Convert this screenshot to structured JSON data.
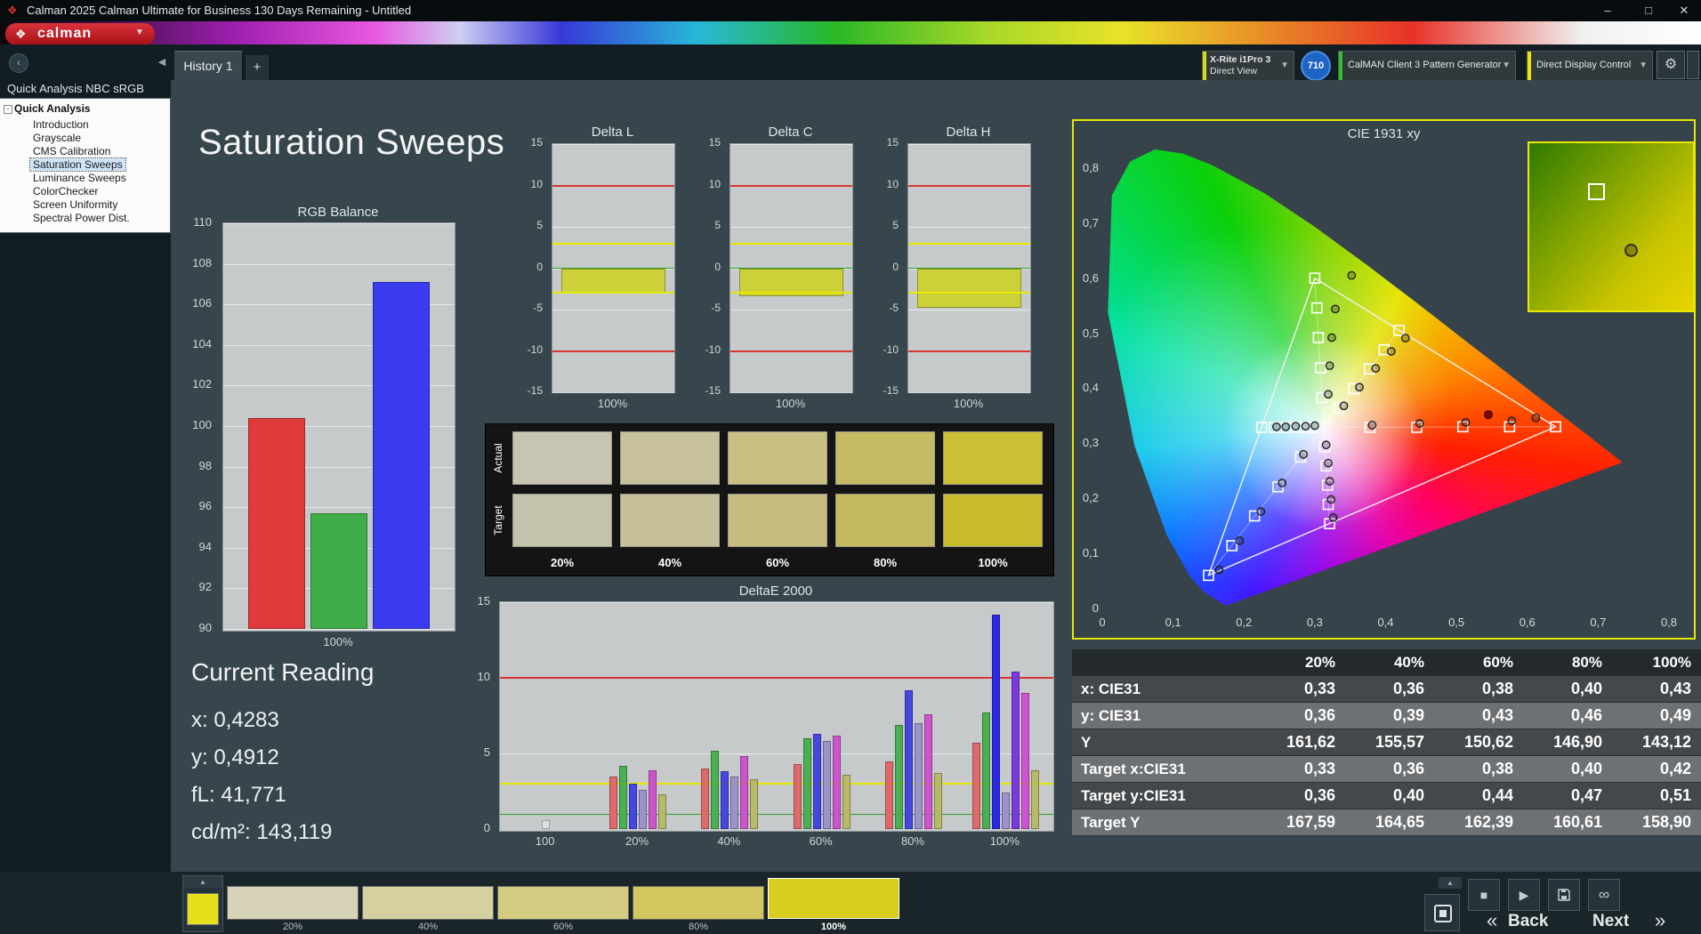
{
  "window": {
    "title": "Calman 2025 Calman Ultimate for Business 130 Days Remaining - Untitled",
    "minimize": "–",
    "maximize": "□",
    "close": "✕"
  },
  "logo": {
    "text": "calman"
  },
  "tabs": {
    "active": "History 1",
    "add_label": "+"
  },
  "devices": {
    "meter_line1": "X-Rite i1Pro 3",
    "meter_line2": "Direct View",
    "badge": "710",
    "pattern": "CalMAN Client 3 Pattern Generator",
    "display": "Direct Display Control"
  },
  "sidebar": {
    "workflow_title": "Quick Analysis NBC sRGB",
    "root": "Quick Analysis",
    "items": [
      "Introduction",
      "Grayscale",
      "CMS Calibration",
      "Saturation Sweeps",
      "Luminance Sweeps",
      "ColorChecker",
      "Screen Uniformity",
      "Spectral Power Dist."
    ],
    "selected": "Saturation Sweeps"
  },
  "page": {
    "title": "Saturation Sweeps"
  },
  "current_reading": {
    "title": "Current Reading",
    "x": "x: 0,4283",
    "y": "y: 0,4912",
    "fl": "fL: 41,771",
    "cd": "cd/m²: 143,119"
  },
  "rgb_chart": {
    "type": "bar",
    "title": "RGB Balance",
    "xlabel": "100%",
    "ymin": 90,
    "ymax": 110,
    "yticks": [
      110,
      108,
      106,
      104,
      102,
      100,
      98,
      96,
      94,
      92,
      90
    ],
    "bars": [
      {
        "name": "red",
        "color": "#e03a3a",
        "value": 100.4
      },
      {
        "name": "green",
        "color": "#3fae4a",
        "value": 95.7
      },
      {
        "name": "blue",
        "color": "#3a3aee",
        "value": 107.1
      }
    ]
  },
  "delta_charts": {
    "type": "bar",
    "ymin": -15,
    "ymax": 15,
    "yticks": [
      15,
      10,
      5,
      0,
      -5,
      -10,
      -15
    ],
    "xlabel": "100%",
    "bar_color": "#ccd13a",
    "limit_lines": [
      {
        "v": 10,
        "color": "#d83434",
        "w": 2
      },
      {
        "v": -10,
        "color": "#d83434",
        "w": 2
      },
      {
        "v": 3,
        "color": "#e8e800",
        "w": 2
      },
      {
        "v": -3,
        "color": "#e8e800",
        "w": 2
      },
      {
        "v": 0,
        "color": "#2aa02a",
        "w": 1
      }
    ],
    "charts": [
      {
        "title": "Delta L",
        "value": -3.0
      },
      {
        "title": "Delta C",
        "value": -3.4
      },
      {
        "title": "Delta H",
        "value": -4.8
      }
    ]
  },
  "swatch_table": {
    "row_labels": [
      "Actual",
      "Target"
    ],
    "col_labels": [
      "20%",
      "40%",
      "60%",
      "80%",
      "100%"
    ],
    "actual": [
      "#c7c4b1",
      "#c8c29c",
      "#c8bf83",
      "#c6ba62",
      "#cbbf33"
    ],
    "target": [
      "#c4c1ad",
      "#c6c098",
      "#c7bd80",
      "#c5b95f",
      "#c9bc2c"
    ]
  },
  "deltae_chart": {
    "type": "bar",
    "title": "DeltaE 2000",
    "ymin": 0,
    "ymax": 15,
    "yticks": [
      0,
      5,
      10,
      15
    ],
    "limit_lines": [
      {
        "v": 10,
        "color": "#d83434",
        "w": 2
      },
      {
        "v": 3,
        "color": "#e8e800",
        "w": 2
      },
      {
        "v": 1,
        "color": "#2aa02a",
        "w": 1
      }
    ],
    "groups": [
      {
        "label": "100",
        "bars": [
          {
            "c": "#e0e0e0",
            "v": 0.6
          }
        ]
      },
      {
        "label": "20%",
        "bars": [
          {
            "c": "#e06a6a",
            "v": 3.5
          },
          {
            "c": "#4ab051",
            "v": 4.2
          },
          {
            "c": "#4646e0",
            "v": 3.0
          },
          {
            "c": "#9b93c9",
            "v": 2.6
          },
          {
            "c": "#cc55cc",
            "v": 3.9
          },
          {
            "c": "#b9b96a",
            "v": 2.3
          }
        ]
      },
      {
        "label": "40%",
        "bars": [
          {
            "c": "#e06a6a",
            "v": 4.0
          },
          {
            "c": "#4ab051",
            "v": 5.2
          },
          {
            "c": "#4646e0",
            "v": 3.8
          },
          {
            "c": "#9b93c9",
            "v": 3.5
          },
          {
            "c": "#cc55cc",
            "v": 4.8
          },
          {
            "c": "#b9b96a",
            "v": 3.3
          }
        ]
      },
      {
        "label": "60%",
        "bars": [
          {
            "c": "#e06a6a",
            "v": 4.3
          },
          {
            "c": "#4ab051",
            "v": 6.0
          },
          {
            "c": "#4646e0",
            "v": 6.3
          },
          {
            "c": "#9b93c9",
            "v": 5.8
          },
          {
            "c": "#cc55cc",
            "v": 6.2
          },
          {
            "c": "#b9b96a",
            "v": 3.6
          }
        ]
      },
      {
        "label": "80%",
        "bars": [
          {
            "c": "#e06a6a",
            "v": 4.5
          },
          {
            "c": "#4ab051",
            "v": 6.9
          },
          {
            "c": "#4646e0",
            "v": 9.2
          },
          {
            "c": "#9b93c9",
            "v": 7.0
          },
          {
            "c": "#cc55cc",
            "v": 7.6
          },
          {
            "c": "#b9b96a",
            "v": 3.7
          }
        ]
      },
      {
        "label": "100%",
        "bars": [
          {
            "c": "#e06a6a",
            "v": 5.7
          },
          {
            "c": "#4ab051",
            "v": 7.7
          },
          {
            "c": "#2a2ae8",
            "v": 14.2
          },
          {
            "c": "#9b93c9",
            "v": 2.4
          },
          {
            "c": "#7a3ae0",
            "v": 10.4
          },
          {
            "c": "#d054d0",
            "v": 9.0
          },
          {
            "c": "#b9b96a",
            "v": 3.9
          }
        ]
      }
    ]
  },
  "cie_chart": {
    "type": "scatter",
    "title": "CIE 1931 xy",
    "tick_labels": [
      "0",
      "0,1",
      "0,2",
      "0,3",
      "0,4",
      "0,5",
      "0,6",
      "0,7",
      "0,8"
    ],
    "xmax": 0.8,
    "ymax": 0.85,
    "triangle": [
      [
        0.64,
        0.33
      ],
      [
        0.3,
        0.6
      ],
      [
        0.15,
        0.06
      ]
    ],
    "white_point": [
      0.3127,
      0.329
    ],
    "sweep_ends": [
      [
        0.64,
        0.33
      ],
      [
        0.3,
        0.6
      ],
      [
        0.15,
        0.06
      ],
      [
        0.419,
        0.505
      ],
      [
        0.225,
        0.329
      ],
      [
        0.321,
        0.154
      ]
    ],
    "targets": [
      [
        0.378,
        0.329
      ],
      [
        0.444,
        0.329
      ],
      [
        0.509,
        0.33
      ],
      [
        0.575,
        0.33
      ],
      [
        0.64,
        0.33
      ],
      [
        0.31,
        0.383
      ],
      [
        0.308,
        0.437
      ],
      [
        0.305,
        0.492
      ],
      [
        0.303,
        0.546
      ],
      [
        0.3,
        0.6
      ],
      [
        0.28,
        0.275
      ],
      [
        0.248,
        0.221
      ],
      [
        0.215,
        0.168
      ],
      [
        0.183,
        0.114
      ],
      [
        0.15,
        0.06
      ],
      [
        0.334,
        0.364
      ],
      [
        0.355,
        0.399
      ],
      [
        0.377,
        0.435
      ],
      [
        0.398,
        0.47
      ],
      [
        0.419,
        0.505
      ],
      [
        0.295,
        0.329
      ],
      [
        0.278,
        0.329
      ],
      [
        0.26,
        0.329
      ],
      [
        0.243,
        0.329
      ],
      [
        0.225,
        0.329
      ],
      [
        0.314,
        0.294
      ],
      [
        0.316,
        0.259
      ],
      [
        0.318,
        0.224
      ],
      [
        0.319,
        0.189
      ],
      [
        0.321,
        0.154
      ]
    ],
    "measured": [
      [
        0.381,
        0.333
      ],
      [
        0.448,
        0.336
      ],
      [
        0.513,
        0.338
      ],
      [
        0.578,
        0.341
      ],
      [
        0.612,
        0.346
      ],
      [
        0.319,
        0.389
      ],
      [
        0.321,
        0.441
      ],
      [
        0.324,
        0.492
      ],
      [
        0.329,
        0.544
      ],
      [
        0.352,
        0.605
      ],
      [
        0.284,
        0.28
      ],
      [
        0.254,
        0.228
      ],
      [
        0.224,
        0.176
      ],
      [
        0.194,
        0.123
      ],
      [
        0.165,
        0.07
      ],
      [
        0.341,
        0.368
      ],
      [
        0.363,
        0.402
      ],
      [
        0.386,
        0.436
      ],
      [
        0.408,
        0.467
      ],
      [
        0.428,
        0.491
      ],
      [
        0.3,
        0.332
      ],
      [
        0.287,
        0.331
      ],
      [
        0.273,
        0.331
      ],
      [
        0.259,
        0.33
      ],
      [
        0.246,
        0.33
      ],
      [
        0.316,
        0.297
      ],
      [
        0.319,
        0.264
      ],
      [
        0.321,
        0.231
      ],
      [
        0.323,
        0.198
      ],
      [
        0.326,
        0.165
      ]
    ],
    "measured_filled": [
      [
        0.545,
        0.352
      ]
    ]
  },
  "results_table": {
    "headers": [
      "",
      "20%",
      "40%",
      "60%",
      "80%",
      "100%"
    ],
    "rows": [
      [
        "x: CIE31",
        "0,33",
        "0,36",
        "0,38",
        "0,40",
        "0,43"
      ],
      [
        "y: CIE31",
        "0,36",
        "0,39",
        "0,43",
        "0,46",
        "0,49"
      ],
      [
        "Y",
        "161,62",
        "155,57",
        "150,62",
        "146,90",
        "143,12"
      ],
      [
        "Target x:CIE31",
        "0,33",
        "0,36",
        "0,38",
        "0,40",
        "0,42"
      ],
      [
        "Target y:CIE31",
        "0,36",
        "0,40",
        "0,44",
        "0,47",
        "0,51"
      ],
      [
        "Target Y",
        "167,59",
        "164,65",
        "162,39",
        "160,61",
        "158,90"
      ]
    ]
  },
  "bottom_bar": {
    "well_color": "#e8df1c",
    "swatches": [
      {
        "label": "20%",
        "color": "#d6d3b8"
      },
      {
        "label": "40%",
        "color": "#d5d0a0"
      },
      {
        "label": "60%",
        "color": "#d3cb82"
      },
      {
        "label": "80%",
        "color": "#d2c65e"
      },
      {
        "label": "100%",
        "color": "#d9ce1e"
      }
    ],
    "selected": "100%",
    "back": "Back",
    "next": "Next"
  }
}
